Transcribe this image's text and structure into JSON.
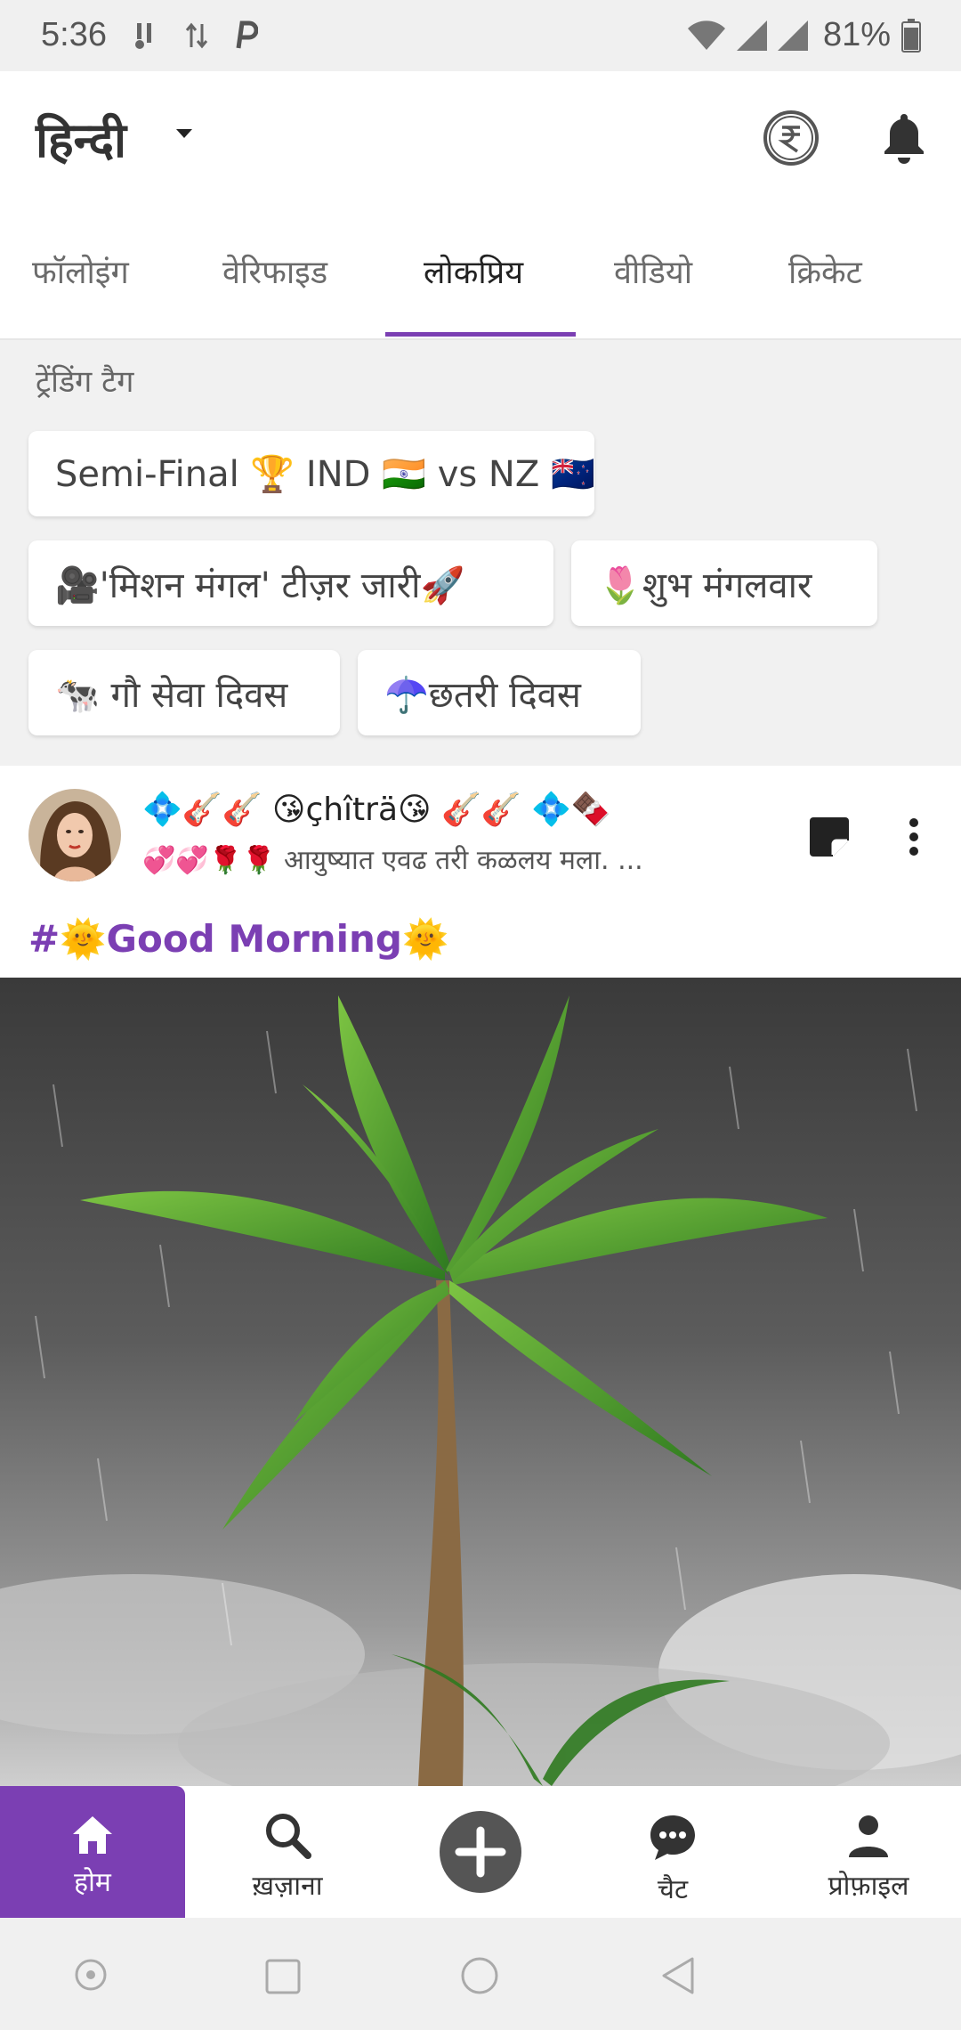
{
  "status_bar": {
    "time": "5:36",
    "battery": "81%"
  },
  "header": {
    "language": "हिन्दी"
  },
  "tabs": [
    {
      "label": "फॉलोइंग"
    },
    {
      "label": "वेरिफाइड"
    },
    {
      "label": "लोकप्रिय"
    },
    {
      "label": "वीडियो"
    },
    {
      "label": "क्रिकेट"
    }
  ],
  "active_tab": "लोकप्रिय",
  "trending": {
    "title": "ट्रेंडिंग टैग",
    "tags": [
      {
        "label": "Semi-Final 🏆 IND 🇮🇳 vs NZ 🇳🇿"
      },
      {
        "label": "🎥'मिशन मंगल' टीज़र जारी🚀"
      },
      {
        "label": "🌷शुभ मंगलवार"
      },
      {
        "label": "🐄 गौ सेवा दिवस"
      },
      {
        "label": "☂️छतरी दिवस"
      }
    ]
  },
  "post": {
    "author": "💠🎸🎸 😘çhîträ😘 🎸🎸 💠🍫",
    "status": "💞💞🌹🌹 आयुष्यात एवढ तरी कळलय मला. ...",
    "hashtag": "#🌞Good Morning🌞"
  },
  "bottom_nav": {
    "home": "होम",
    "explore": "ख़ज़ाना",
    "chat": "चैट",
    "profile": "प्रोफ़ाइल"
  },
  "colors": {
    "accent": "#7b3fb3",
    "status_bar_bg": "#f0f0f0",
    "trending_bg": "#f1f1f1"
  },
  "icons": [
    "signal-icon",
    "wifi-icon",
    "battery-icon",
    "rupee-coin-icon",
    "bell-icon",
    "sticker-icon",
    "more-vert-icon",
    "home-icon",
    "search-icon",
    "add-circle-icon",
    "chat-icon",
    "person-icon"
  ]
}
